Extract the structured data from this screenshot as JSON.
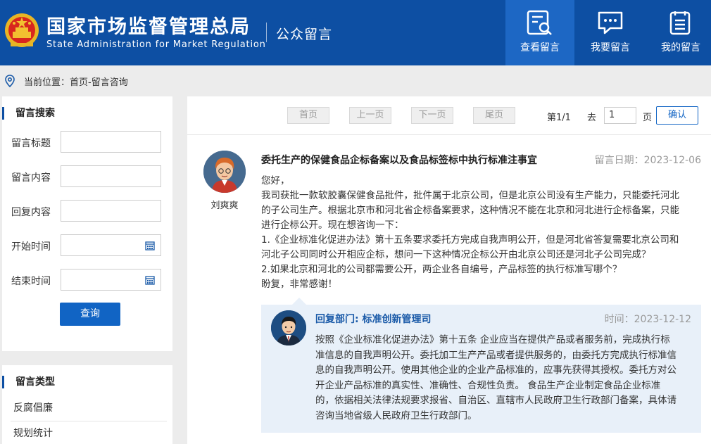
{
  "header": {
    "title_cn": "国家市场监督管理总局",
    "title_en": "State Administration for Market Regulation",
    "section": "公众留言",
    "nav": [
      {
        "label": "查看留言",
        "icon": "search-document-icon",
        "active": true
      },
      {
        "label": "我要留言",
        "icon": "chat-bubble-icon",
        "active": false
      },
      {
        "label": "我的留言",
        "icon": "list-document-icon",
        "active": false
      }
    ],
    "colors": {
      "header_bg": "#0d4fa3",
      "active_bg": "#1d67c4"
    }
  },
  "breadcrumb": {
    "text": "当前位置：首页-留言咨询",
    "icon": "location-pin-icon"
  },
  "search_panel": {
    "title": "留言搜索",
    "fields": [
      {
        "label": "留言标题",
        "value": ""
      },
      {
        "label": "留言内容",
        "value": ""
      },
      {
        "label": "回复内容",
        "value": ""
      },
      {
        "label": "开始时间",
        "value": ""
      },
      {
        "label": "结束时间",
        "value": ""
      }
    ],
    "query_button": "查询"
  },
  "type_panel": {
    "title": "留言类型",
    "items": [
      "反腐倡廉",
      "规划统计"
    ]
  },
  "pager": {
    "first": "首页",
    "prev": "上一页",
    "next": "下一页",
    "last": "尾页",
    "status": "第1/1",
    "goto_label": "去",
    "goto_value": "1",
    "page_unit": "页",
    "confirm": "确认"
  },
  "message": {
    "author": "刘爽爽",
    "title": "委托生产的保健食品企标备案以及食品标签标中执行标准注事宜",
    "date_label": "留言日期：2023-12-06",
    "body": [
      "您好，",
      "我司获批一款软胶囊保健食品批件，批件属于北京公司，但是北京公司没有生产能力，只能委托河北",
      "的子公司生产。根据北京市和河北省企标备案要求，这种情况不能在北京和河北进行企标备案，只能",
      "进行企标公开。现在想咨询一下：",
      "1.《企业标准化促进办法》第十五条要求委托方完成自我声明公开，但是河北省答复需要北京公司和",
      "河北子公司同时公开相应企标，想问一下这种情况企标公开由北京公司还是河北子公司完成？",
      "2.如果北京和河北的公司都需要公开，两企业各自编号，产品标签的执行标准写哪个？",
      "盼复，非常感谢！"
    ]
  },
  "reply": {
    "dept": "回复部门: 标准创新管理司",
    "date_label": "时间：2023-12-12",
    "body": [
      "按照《企业标准化促进办法》第十五条 企业应当在提供产品或者服务前，完成执行标",
      "准信息的自我声明公开。委托加工生产产品或者提供服务的，由委托方完成执行标准信",
      "息的自我声明公开。使用其他企业的企业产品标准的，应事先获得其授权。委托方对公",
      "开企业产品标准的真实性、准确性、合规性负责。 食品生产企业制定食品企业标准",
      "的，依据相关法律法规要求报省、自治区、直辖市人民政府卫生行政部门备案，具体请",
      "咨询当地省级人民政府卫生行政部门。"
    ]
  }
}
